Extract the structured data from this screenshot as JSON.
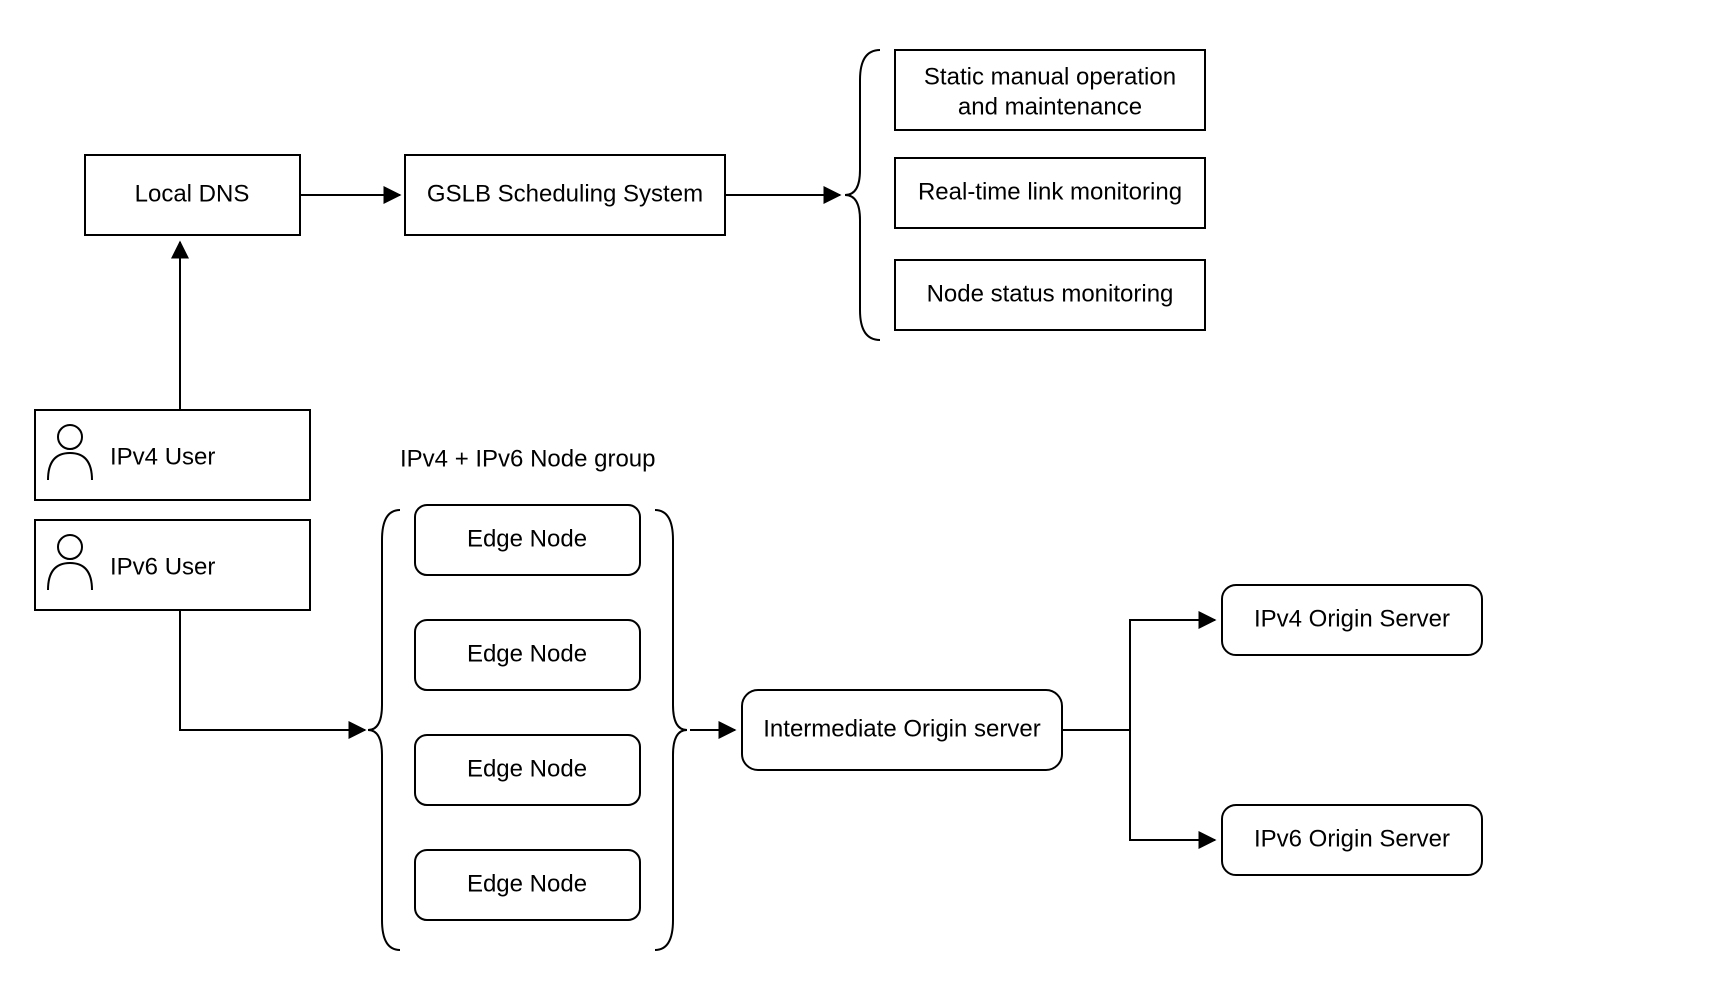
{
  "diagram": {
    "local_dns": "Local DNS",
    "gslb": "GSLB Scheduling System",
    "feature_static_1": "Static manual operation",
    "feature_static_2": "and maintenance",
    "feature_link": "Real-time link monitoring",
    "feature_node": "Node status monitoring",
    "ipv4_user": "IPv4 User",
    "ipv6_user": "IPv6 User",
    "node_group_title": "IPv4 + IPv6 Node group",
    "edge_node": "Edge Node",
    "intermediate": "Intermediate Origin server",
    "origin_v4": "IPv4 Origin Server",
    "origin_v6": "IPv6 Origin Server"
  }
}
